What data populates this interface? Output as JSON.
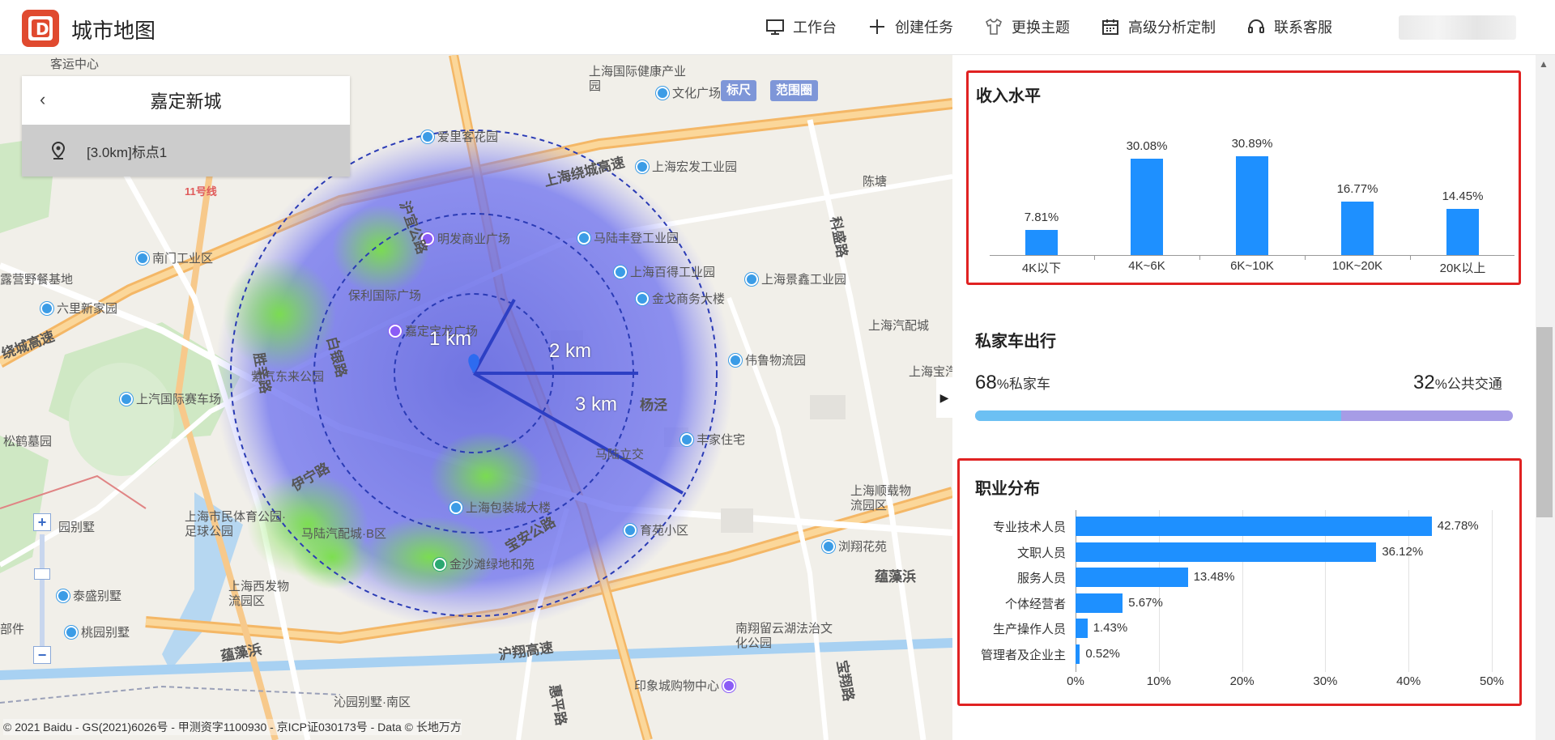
{
  "app": {
    "title": "城市地图"
  },
  "nav": [
    {
      "label": "工作台",
      "icon": "monitor-icon"
    },
    {
      "label": "创建任务",
      "icon": "plus-icon"
    },
    {
      "label": "更换主题",
      "icon": "shirt-icon"
    },
    {
      "label": "高级分析定制",
      "icon": "calendar-icon"
    },
    {
      "label": "联系客服",
      "icon": "headset-icon"
    }
  ],
  "location_panel": {
    "title": "嘉定新城",
    "point_label": "[3.0km]标点1"
  },
  "map": {
    "tools": {
      "ruler": "标尺",
      "range": "范围圈"
    },
    "radius_labels": [
      "1 km",
      "2 km",
      "3 km"
    ],
    "pois": [
      "客运中心",
      "上海国际健康产业园",
      "文化广场",
      "爱里客花园",
      "上海宏发工业园",
      "陈塘",
      "南门工业区",
      "明发商业广场",
      "马陆丰登工业园",
      "上海百得工业园",
      "上海景鑫工业园",
      "露营野餐基地",
      "六里新家园",
      "保利国际广场",
      "金戈商务大楼",
      "嘉定宝龙广场",
      "紫气东来公园",
      "上海汽配城",
      "伟鲁物流园",
      "上汽国际赛车场",
      "丰家住宅",
      "松鹤墓园",
      "上海市民体育公园·足球公园",
      "马陆汽配城·B区",
      "上海包装城大楼",
      "育苑小区",
      "浏翔花苑",
      "上海顺载物流园区",
      "上海西发物流园区",
      "泰盛别墅",
      "桃园别墅",
      "金沙滩绿地和苑",
      "南翔留云湖法治文化公园",
      "印象城购物中心",
      "沁园别墅·南区",
      "上海宝汽配市",
      "马陆立交",
      "园别墅",
      "部件"
    ],
    "roads": [
      "上海绕城高速",
      "沪宜公路",
      "胜辛路",
      "白银路",
      "伊宁路",
      "宝安公路",
      "沪翔高速",
      "科盛路",
      "杨泾",
      "蕴藻浜",
      "沪宜公路",
      "绕城高速",
      "11号线",
      "宝翔路",
      "惠平路"
    ],
    "copyright": "© 2021 Baidu - GS(2021)6026号 - 甲测资字1100930 - 京ICP证030173号 - Data © 长地万方"
  },
  "income": {
    "title": "收入水平",
    "chart_data": {
      "type": "bar",
      "categories": [
        "4K以下",
        "4K~6K",
        "6K~10K",
        "10K~20K",
        "20K以上"
      ],
      "values": [
        7.81,
        30.08,
        30.89,
        16.77,
        14.45
      ],
      "value_labels": [
        "7.81%",
        "30.08%",
        "30.89%",
        "16.77%",
        "14.45%"
      ],
      "ylim": [
        0,
        30.89
      ],
      "color": "#1e90ff"
    }
  },
  "car": {
    "title": "私家车出行",
    "private_pct": 68,
    "private_unit": "%",
    "private_label": "私家车",
    "public_pct": 32,
    "public_unit": "%",
    "public_label": "公共交通",
    "private_color": "#6cc0f3",
    "public_color": "#a69ce6"
  },
  "occupation": {
    "title": "职业分布",
    "chart_data": {
      "type": "bar",
      "orientation": "horizontal",
      "categories": [
        "专业技术人员",
        "文职人员",
        "服务人员",
        "个体经营者",
        "生产操作人员",
        "管理者及企业主"
      ],
      "values": [
        42.78,
        36.12,
        13.48,
        5.67,
        1.43,
        0.52
      ],
      "value_labels": [
        "42.78%",
        "36.12%",
        "13.48%",
        "5.67%",
        "1.43%",
        "0.52%"
      ],
      "xlim": [
        0,
        50
      ],
      "x_ticks": [
        "0%",
        "10%",
        "20%",
        "30%",
        "40%",
        "50%"
      ],
      "grid": true,
      "color": "#1e90ff"
    }
  }
}
